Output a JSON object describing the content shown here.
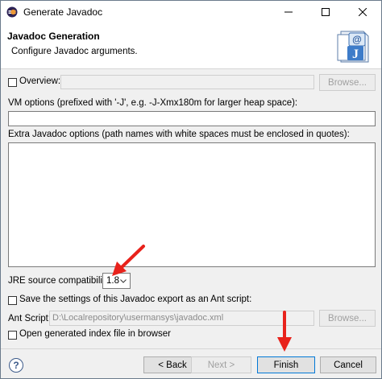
{
  "window": {
    "title": "Generate Javadoc",
    "buttons": {
      "minimize": "minimize-icon",
      "maximize": "maximize-icon",
      "close": "close-icon"
    }
  },
  "banner": {
    "title": "Javadoc Generation",
    "subtitle": "Configure Javadoc arguments.",
    "icon": "javadoc-wizard-icon"
  },
  "overview": {
    "label": "Overview:",
    "checked": false,
    "value": "",
    "browse_label": "Browse..."
  },
  "vm_options": {
    "label": "VM options (prefixed with '-J', e.g. -J-Xmx180m for larger heap space):",
    "value": ""
  },
  "extra_options": {
    "label": "Extra Javadoc options (path names with white spaces must be enclosed in quotes):",
    "value": ""
  },
  "jre": {
    "label": "JRE source compatibility:",
    "value": "1.8"
  },
  "save_settings": {
    "label": "Save the settings of this Javadoc export as an Ant script:",
    "checked": false
  },
  "ant_script": {
    "label": "Ant Script:",
    "value": "D:\\Localrepository\\usermansys\\javadoc.xml",
    "browse_label": "Browse..."
  },
  "open_index": {
    "label": "Open generated index file in browser",
    "checked": false
  },
  "footer": {
    "help_label": "?",
    "back_label": "< Back",
    "next_label": "Next >",
    "finish_label": "Finish",
    "cancel_label": "Cancel"
  },
  "annotation_color": "#e8221b"
}
